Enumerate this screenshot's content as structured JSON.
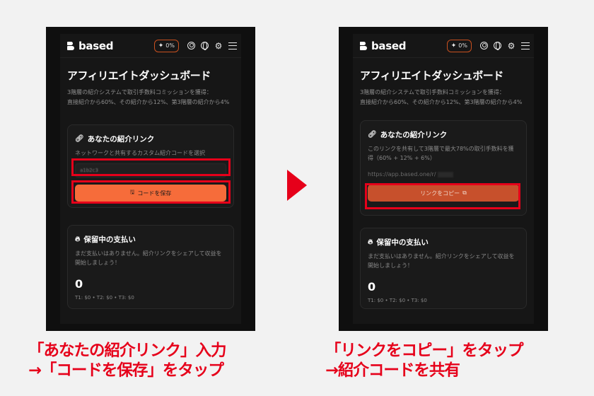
{
  "left_screen": {
    "brand": "based",
    "pct": "0%",
    "page_title": "アフィリエイトダッシュボード",
    "desc": [
      "3階層の紹介システムで取引手数料コミッションを獲得：",
      "直接紹介から60%、その紹介から12%、第3階層の紹介から4%"
    ],
    "link_card": {
      "title": "あなたの紹介リンク",
      "sub": "ネットワークと共有するカスタム紹介コードを選択",
      "code_value": "a1b2c3",
      "save_button": "コードを保存"
    },
    "pending_card": {
      "title": "保留中の支払い",
      "sub": "まだ支払いはありません。紹介リンクをシェアして収益を開始しましょう！",
      "amount": "0",
      "tiers": "T1: $0 • T2: $0 • T3: $0"
    }
  },
  "right_screen": {
    "brand": "based",
    "pct": "0%",
    "page_title": "アフィリエイトダッシュボード",
    "desc": [
      "3階層の紹介システムで取引手数料コミッションを獲得：",
      "直接紹介から60%、その紹介から12%、第3階層の紹介から4%"
    ],
    "link_card": {
      "title": "あなたの紹介リンク",
      "sub": "このリンクを共有して3階層で最大78%の取引手数料を獲得（60% + 12% + 6%）",
      "url": "https://app.based.one/r/",
      "copy_button": "リンクをコピー"
    },
    "pending_card": {
      "title": "保留中の支払い",
      "sub": "まだ支払いはありません。紹介リンクをシェアして収益を開始しましょう！",
      "amount": "0",
      "tiers": "T1: $0 • T2: $0 • T3: $0"
    }
  },
  "captions": {
    "left_line1": "「あなたの紹介リンク」入力",
    "left_line2": "→「コードを保存」をタップ",
    "right_line1": "「リンクをコピー」をタップ",
    "right_line2": "→紹介コードを共有"
  },
  "colors": {
    "highlight": "#e6001a",
    "accent": "#f66c3a"
  }
}
